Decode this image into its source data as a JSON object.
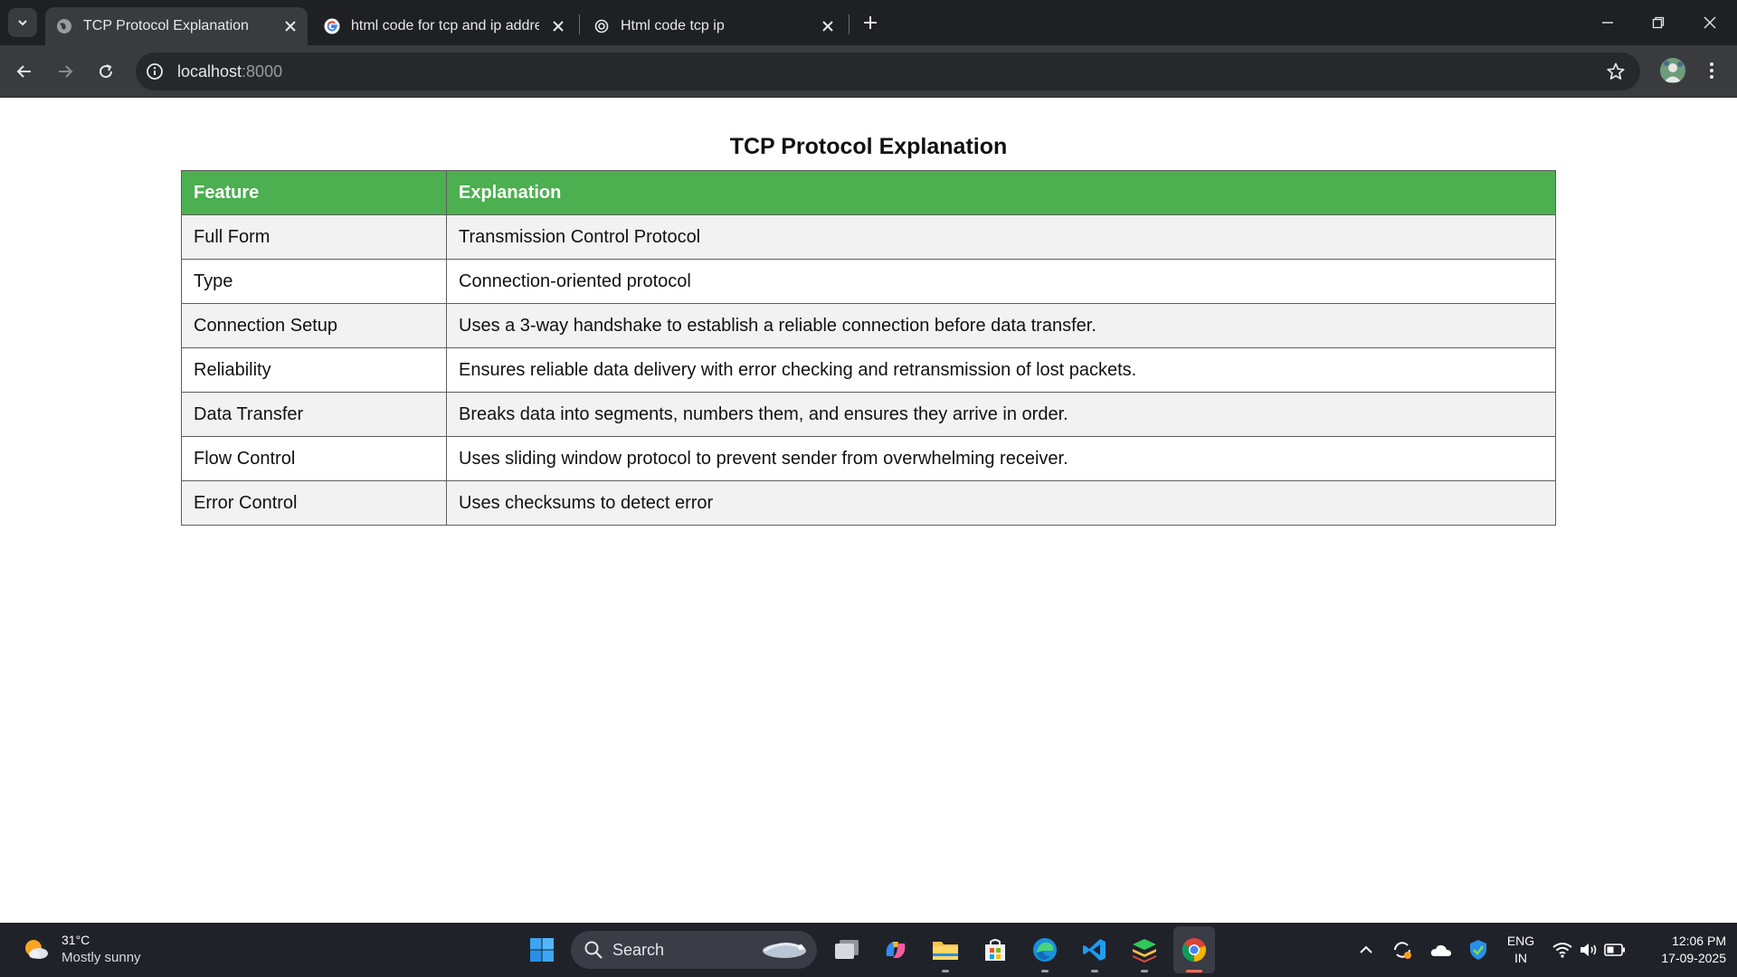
{
  "browser": {
    "tabs": [
      {
        "title": "TCP Protocol Explanation",
        "active": true,
        "favicon": "globe-icon"
      },
      {
        "title": "html code for tcp and ip addres",
        "active": false,
        "favicon": "google-icon"
      },
      {
        "title": "Html code tcp ip",
        "active": false,
        "favicon": "chatgpt-icon"
      }
    ],
    "address": {
      "host": "localhost",
      "port": ":8000"
    }
  },
  "page": {
    "title": "TCP Protocol Explanation",
    "table": {
      "headers": [
        "Feature",
        "Explanation"
      ],
      "rows": [
        [
          "Full Form",
          "Transmission Control Protocol"
        ],
        [
          "Type",
          "Connection-oriented protocol"
        ],
        [
          "Connection Setup",
          "Uses a 3-way handshake to establish a reliable connection before data transfer."
        ],
        [
          "Reliability",
          "Ensures reliable data delivery with error checking and retransmission of lost packets."
        ],
        [
          "Data Transfer",
          "Breaks data into segments, numbers them, and ensures they arrive in order."
        ],
        [
          "Flow Control",
          "Uses sliding window protocol to prevent sender from overwhelming receiver."
        ],
        [
          "Error Control",
          "Uses checksums to detect error"
        ]
      ]
    }
  },
  "colors": {
    "header_green": "#4caf50",
    "stripe": "#f2f2f2",
    "chrome_dark": "#1f2023",
    "chrome_mid": "#3a3b3f"
  },
  "taskbar": {
    "weather": {
      "temp": "31°C",
      "condition": "Mostly sunny"
    },
    "search_label": "Search",
    "language": {
      "line1": "ENG",
      "line2": "IN"
    },
    "clock": {
      "time": "12:06 PM",
      "date": "17-09-2025"
    },
    "apps": [
      "windows-start-icon",
      "search-icon",
      "task-view-icon",
      "copilot-icon",
      "file-explorer-icon",
      "microsoft-store-icon",
      "edge-icon",
      "vscode-icon",
      "stack-app-icon",
      "chrome-icon"
    ],
    "tray": [
      "chevron-up-icon",
      "sync-icon",
      "onedrive-icon",
      "defender-icon",
      "wifi-icon",
      "volume-icon",
      "battery-icon"
    ]
  }
}
